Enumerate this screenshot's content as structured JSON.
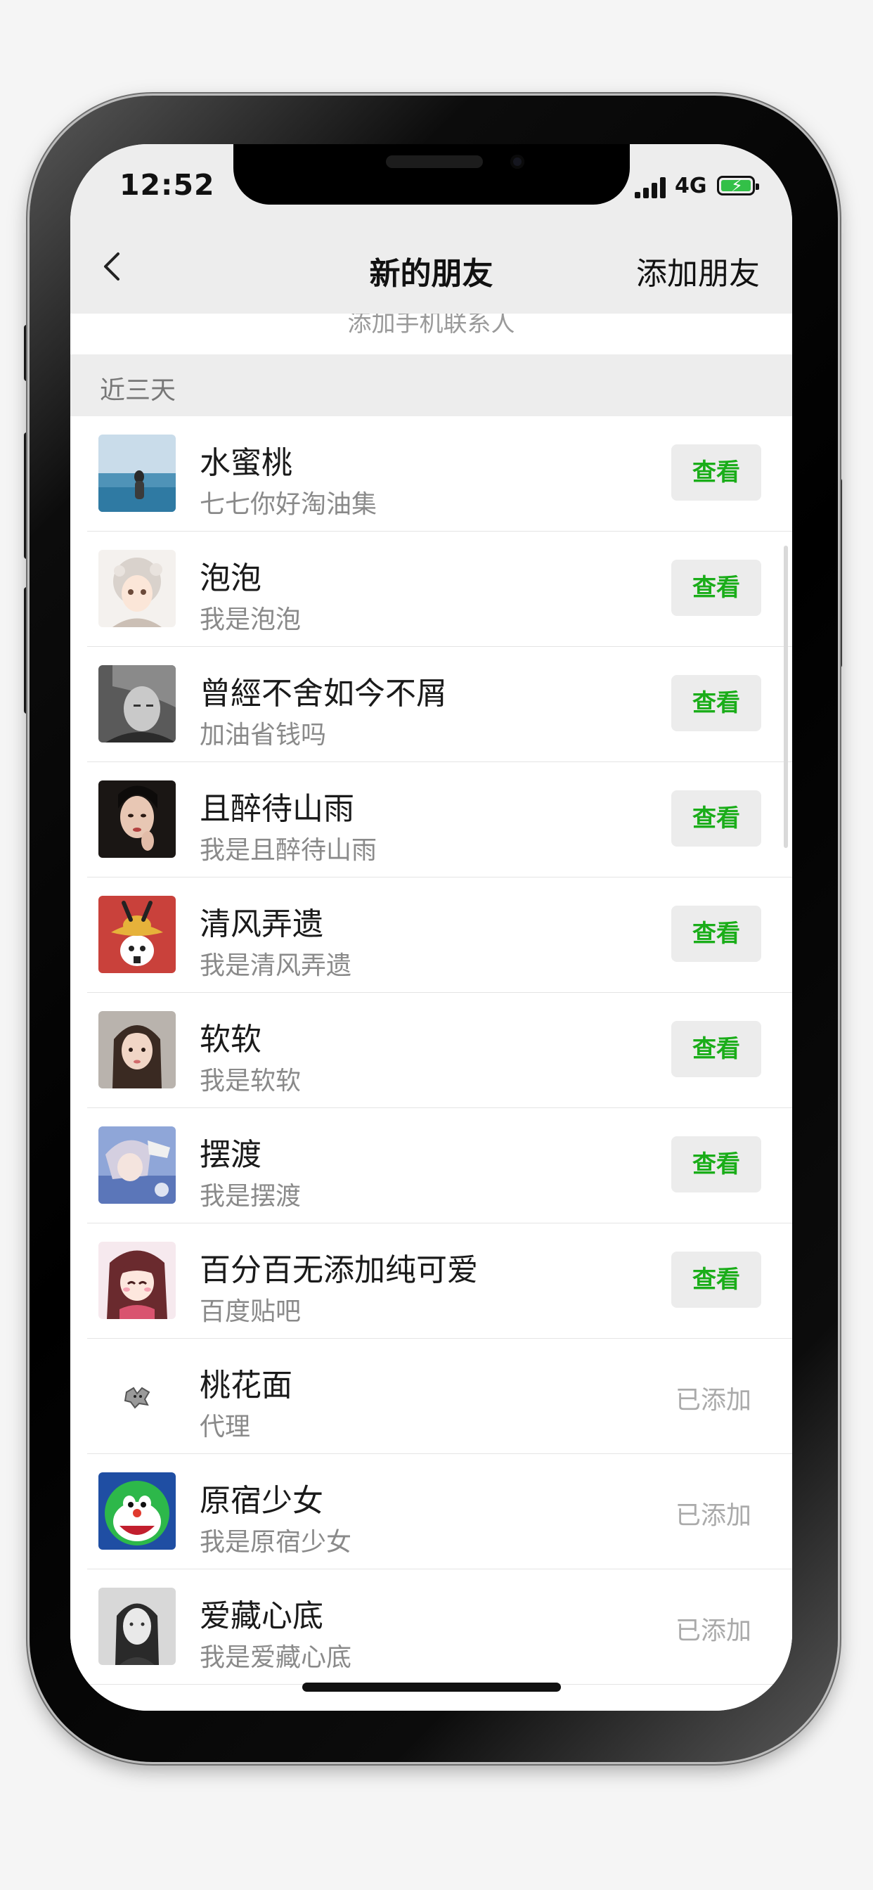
{
  "status_bar": {
    "time": "12:52",
    "network": "4G",
    "battery_charging": true,
    "battery_color": "#33c048"
  },
  "nav": {
    "back_icon": "chevron-left-icon",
    "title": "新的朋友",
    "action": "添加朋友"
  },
  "add_contacts_label": "添加手机联系人",
  "section_label": "近三天",
  "accent_color": "#1aad19",
  "friends": [
    {
      "name": "水蜜桃",
      "message": "七七你好淘油集",
      "action": "查看",
      "status": "pending"
    },
    {
      "name": "泡泡",
      "message": "我是泡泡",
      "action": "查看",
      "status": "pending"
    },
    {
      "name": "曾經不舍如今不屑",
      "message": "加油省钱吗",
      "action": "查看",
      "status": "pending"
    },
    {
      "name": "且醉待山雨",
      "message": "我是且醉待山雨",
      "action": "查看",
      "status": "pending"
    },
    {
      "name": "清风弄遗",
      "message": "我是清风弄遗",
      "action": "查看",
      "status": "pending"
    },
    {
      "name": "软软",
      "message": "我是软软",
      "action": "查看",
      "status": "pending"
    },
    {
      "name": "摆渡",
      "message": "我是摆渡",
      "action": "查看",
      "status": "pending"
    },
    {
      "name": "百分百无添加纯可爱",
      "message": "百度贴吧",
      "action": "查看",
      "status": "pending"
    },
    {
      "name": "桃花面",
      "message": "代理",
      "action": "已添加",
      "status": "added"
    },
    {
      "name": "原宿少女",
      "message": "我是原宿少女",
      "action": "已添加",
      "status": "added"
    },
    {
      "name": "爱藏心底",
      "message": "我是爱藏心底",
      "action": "已添加",
      "status": "added"
    }
  ]
}
